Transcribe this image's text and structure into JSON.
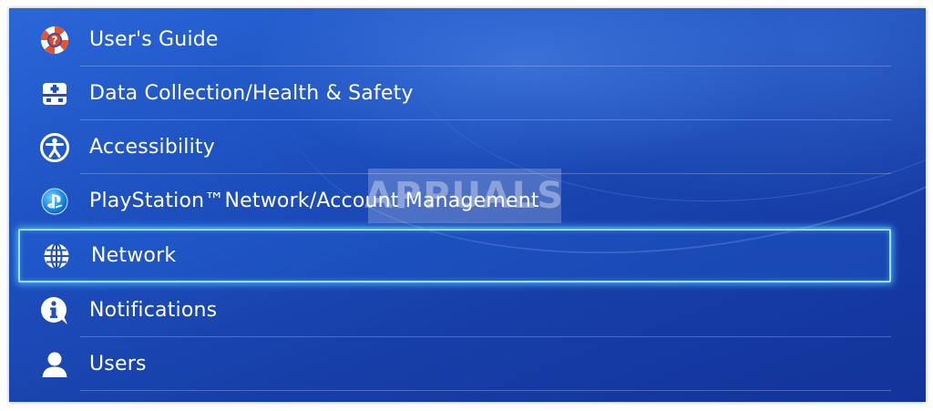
{
  "menu": {
    "items": [
      {
        "label": "User's Guide",
        "icon": "lifebuoy-help-icon"
      },
      {
        "label": "Data Collection/Health & Safety",
        "icon": "health-kit-icon"
      },
      {
        "label": "Accessibility",
        "icon": "accessibility-icon"
      },
      {
        "label": "PlayStation™Network/Account Management",
        "icon": "playstation-network-icon"
      },
      {
        "label": "Network",
        "icon": "globe-icon",
        "selected": true
      },
      {
        "label": "Notifications",
        "icon": "info-notification-icon"
      },
      {
        "label": "Users",
        "icon": "user-icon"
      }
    ]
  },
  "watermark": {
    "text": "APPUALS"
  },
  "colors": {
    "background": "#1d4fbf",
    "selection_glow": "#9fdcff",
    "text": "#ffffff"
  }
}
